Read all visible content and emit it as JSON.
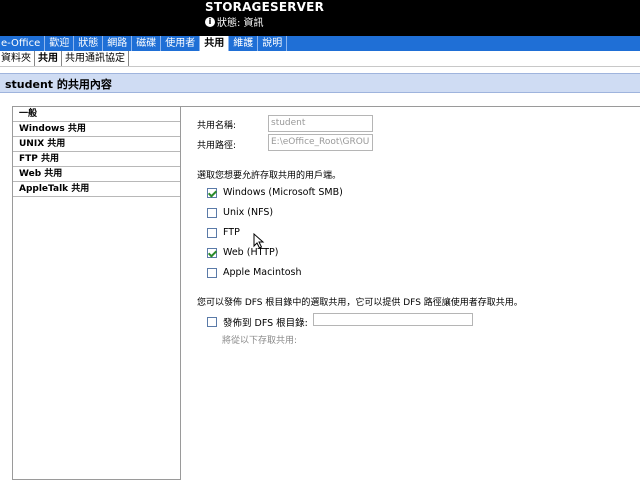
{
  "header": {
    "server_name": "STORAGESERVER",
    "status_icon": "info-icon",
    "status_text": "狀態: 資訊"
  },
  "nav": {
    "items": [
      {
        "label": "e-Office",
        "active": false
      },
      {
        "label": "歡迎",
        "active": false
      },
      {
        "label": "狀態",
        "active": false
      },
      {
        "label": "網路",
        "active": false
      },
      {
        "label": "磁碟",
        "active": false
      },
      {
        "label": "使用者",
        "active": false
      },
      {
        "label": "共用",
        "active": true
      },
      {
        "label": "維護",
        "active": false
      },
      {
        "label": "說明",
        "active": false
      }
    ]
  },
  "subnav": {
    "items": [
      {
        "label": "資料夾",
        "active": false
      },
      {
        "label": "共用",
        "active": true
      },
      {
        "label": "共用通訊協定",
        "active": false
      }
    ]
  },
  "page_title": "student 的共用內容",
  "left_panel": {
    "items": [
      {
        "label": "一般",
        "active": true
      },
      {
        "label": "Windows 共用",
        "active": false
      },
      {
        "label": "UNIX 共用",
        "active": false
      },
      {
        "label": "FTP 共用",
        "active": false
      },
      {
        "label": "Web 共用",
        "active": false
      },
      {
        "label": "AppleTalk 共用",
        "active": false
      }
    ]
  },
  "form": {
    "share_name_label": "共用名稱:",
    "share_name_value": "student",
    "share_path_label": "共用路徑:",
    "share_path_value": "E:\\eOffice_Root\\GROU",
    "clients_prompt": "選取您想要允許存取共用的用戶端。",
    "clients": [
      {
        "label": "Windows (Microsoft SMB)",
        "checked": true
      },
      {
        "label": "Unix (NFS)",
        "checked": false
      },
      {
        "label": "FTP",
        "checked": false
      },
      {
        "label": "Web (HTTP)",
        "checked": true
      },
      {
        "label": "Apple Macintosh",
        "checked": false
      }
    ],
    "dfs_prompt": "您可以發佈 DFS 根目錄中的選取共用，它可以提供 DFS 路徑讓使用者存取共用。",
    "dfs_publish_label": "發佈到 DFS 根目錄:",
    "dfs_publish_checked": false,
    "dfs_root_value": "",
    "dfs_hint": "將從以下存取共用:"
  }
}
